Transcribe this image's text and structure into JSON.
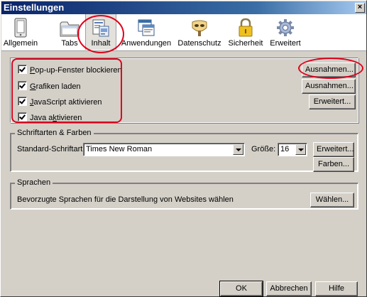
{
  "window": {
    "title": "Einstellungen",
    "close_glyph": "×"
  },
  "toolbar": {
    "items": [
      {
        "label": "Allgemein",
        "icon": "device-icon"
      },
      {
        "label": "Tabs",
        "icon": "folder-tabs-icon"
      },
      {
        "label": "Inhalt",
        "icon": "document-content-icon",
        "selected": true
      },
      {
        "label": "Anwendungen",
        "icon": "applications-icon"
      },
      {
        "label": "Datenschutz",
        "icon": "privacy-mask-icon"
      },
      {
        "label": "Sicherheit",
        "icon": "padlock-icon"
      },
      {
        "label": "Erweitert",
        "icon": "gear-icon"
      }
    ]
  },
  "content": {
    "checkboxes": [
      {
        "label": "Pop-up-Fenster blockieren",
        "accel": "P",
        "checked": true
      },
      {
        "label": "Grafiken laden",
        "accel": "G",
        "checked": true
      },
      {
        "label": "JavaScript aktivieren",
        "accel": "J",
        "checked": true
      },
      {
        "label": "Java aktivieren",
        "accel": "k",
        "checked": true
      }
    ],
    "buttons": {
      "popup_exceptions": "Ausnahmen...",
      "images_exceptions": "Ausnahmen...",
      "js_advanced": "Erweitert..."
    }
  },
  "fonts": {
    "group_label": "Schriftarten & Farben",
    "default_font_label": "Standard-Schriftart:",
    "default_font_value": "Times New Roman",
    "size_label": "Größe:",
    "size_value": "16",
    "advanced_button": "Erweitert...",
    "colors_button": "Farben..."
  },
  "languages": {
    "group_label": "Sprachen",
    "description": "Bevorzugte Sprachen für die Darstellung von Websites wählen",
    "choose_button": "Wählen..."
  },
  "footer": {
    "ok": "OK",
    "cancel": "Abbrechen",
    "help": "Hilfe"
  },
  "colors": {
    "highlight": "#e0001a",
    "titlebar": "#0a246a",
    "dialog": "#d4d0c8"
  }
}
